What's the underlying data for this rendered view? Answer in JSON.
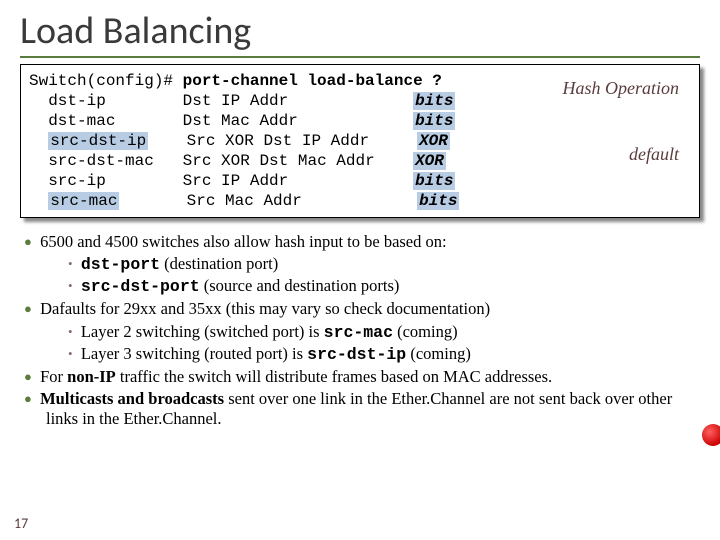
{
  "title": "Load Balancing",
  "cli": {
    "prompt": "Switch(config)# ",
    "command": "port-channel load-balance ?",
    "rows": [
      {
        "opt": "dst-ip",
        "desc": "Dst IP Addr",
        "op": "bits"
      },
      {
        "opt": "dst-mac",
        "desc": "Dst Mac Addr",
        "op": "bits"
      },
      {
        "opt": "src-dst-ip",
        "desc": "Src XOR Dst IP Addr",
        "op": "XOR"
      },
      {
        "opt": "src-dst-mac",
        "desc": "Src XOR Dst Mac Addr",
        "op": "XOR"
      },
      {
        "opt": "src-ip",
        "desc": "Src IP Addr",
        "op": "bits"
      },
      {
        "opt": "src-mac",
        "desc": "Src Mac Addr",
        "op": "bits"
      }
    ],
    "annot_hash": "Hash Operation",
    "annot_default": "default"
  },
  "body": {
    "b1_pre": "6500 and 4500 switches also allow hash input to be based on:",
    "b1a_code": "dst-port",
    "b1a_post": "  (destination port)",
    "b1b_code": "src-dst-port",
    "b1b_post": " (source and destination ports)",
    "b2_pre": "Dafaults for 29xx and 35xx (this may vary so check documentation)",
    "b2a_pre": "Layer 2 switching (switched port) is ",
    "b2a_code": "src-mac",
    "b2a_post": "  (coming)",
    "b2b_pre": "Layer 3 switching (routed port) is ",
    "b2b_code": "src-dst-ip",
    "b2b_post": "  (coming)",
    "b3_pre": "For ",
    "b3_bold": "non-IP",
    "b3_post": " traffic the switch will distribute frames based on MAC addresses.",
    "b4_bold": "Multicasts and broadcasts",
    "b4_post": " sent over one link in the Ether.Channel are not sent back over other links in the Ether.Channel."
  },
  "page": "17"
}
